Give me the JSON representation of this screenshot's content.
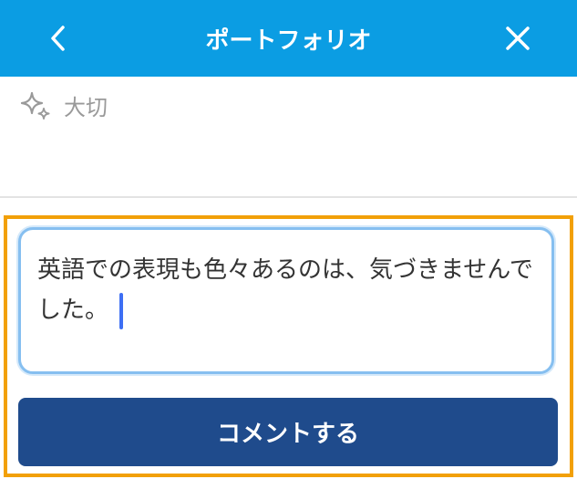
{
  "header": {
    "title": "ポートフォリオ",
    "back_icon": "chevron-left-icon",
    "close_icon": "close-icon",
    "background_color": "#0b9de3"
  },
  "tag": {
    "icon": "sparkle-icon",
    "label": "大切"
  },
  "comment": {
    "value": "英語での表現も色々あるのは、気づきませんでした。",
    "highlight_color": "#f2a008"
  },
  "submit": {
    "label": "コメントする",
    "color": "#1f4b8c"
  }
}
